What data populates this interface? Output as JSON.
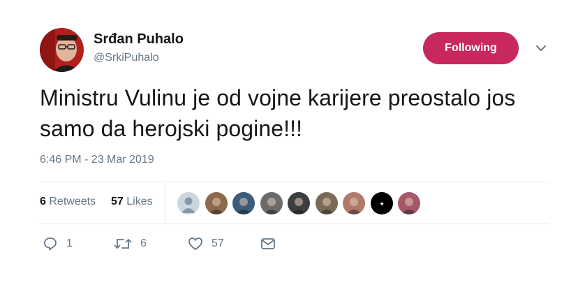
{
  "user": {
    "display_name": "Srđan Puhalo",
    "screen_name": "@SrkiPuhalo"
  },
  "follow_button": {
    "label": "Following",
    "color": "#c8285e"
  },
  "tweet": {
    "text": "Ministru Vulinu je od vojne karijere preostalo jos samo da herojski pogine!!!",
    "timestamp": "6:46 PM - 23 Mar 2019"
  },
  "stats": {
    "retweets_count": "6",
    "retweets_label": "Retweets",
    "likes_count": "57",
    "likes_label": "Likes"
  },
  "likers": [
    {
      "icon": "default-profile-avatar",
      "color": "#ccd6dd"
    },
    {
      "icon": "liker-avatar",
      "color": "#8a6a4a"
    },
    {
      "icon": "liker-avatar",
      "color": "#3a5b7a"
    },
    {
      "icon": "liker-avatar",
      "color": "#6b6b6b"
    },
    {
      "icon": "liker-avatar",
      "color": "#3d3d3d"
    },
    {
      "icon": "liker-avatar",
      "color": "#7a6a58"
    },
    {
      "icon": "liker-avatar",
      "color": "#b07a6a"
    },
    {
      "icon": "liker-avatar",
      "color": "#000000"
    },
    {
      "icon": "liker-avatar",
      "color": "#a4586a"
    }
  ],
  "actions": {
    "reply_count": "1",
    "retweet_count": "6",
    "like_count": "57",
    "icons": [
      "reply-icon",
      "retweet-icon",
      "like-icon",
      "direct-message-icon"
    ]
  },
  "colors": {
    "secondary_text": "#657786",
    "divider": "#e6ecf0"
  }
}
